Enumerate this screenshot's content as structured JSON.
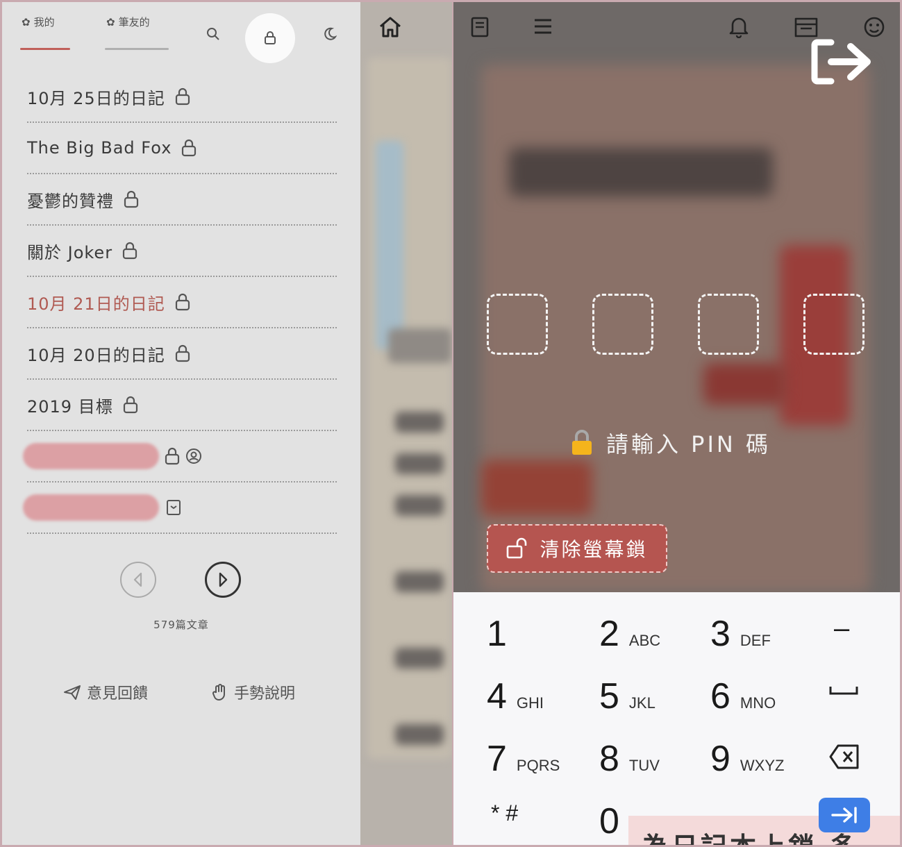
{
  "tabs": {
    "mine_label": "我的",
    "friends_label": "筆友的"
  },
  "diary_entries": [
    {
      "title": "10月 25日的日記",
      "icon": "lock-icon"
    },
    {
      "title": "The Big Bad Fox",
      "icon": "lock-icon"
    },
    {
      "title": "憂鬱的贊禮",
      "icon": "lock-icon"
    },
    {
      "title": "關於 Joker",
      "icon": "lock-icon"
    },
    {
      "title": "10月 21日的日記",
      "icon": "lock-icon",
      "active": true
    },
    {
      "title": "10月 20日的日記",
      "icon": "lock-icon"
    },
    {
      "title": "2019 目標",
      "icon": "lock-icon"
    }
  ],
  "post_count": "579篇文章",
  "footer": {
    "feedback_label": "意見回饋",
    "gesture_label": "手勢說明"
  },
  "pin": {
    "prompt": "請輸入 PIN 碼",
    "clear_label": "清除螢幕鎖"
  },
  "keypad": {
    "keys": [
      {
        "digit": "1",
        "letters": ""
      },
      {
        "digit": "2",
        "letters": "ABC"
      },
      {
        "digit": "3",
        "letters": "DEF"
      },
      {
        "digit": "–",
        "letters": ""
      },
      {
        "digit": "4",
        "letters": "GHI"
      },
      {
        "digit": "5",
        "letters": "JKL"
      },
      {
        "digit": "6",
        "letters": "MNO"
      },
      {
        "digit": "␣",
        "letters": ""
      },
      {
        "digit": "7",
        "letters": "PQRS"
      },
      {
        "digit": "8",
        "letters": "TUV"
      },
      {
        "digit": "9",
        "letters": "WXYZ"
      },
      {
        "digit": "⌫",
        "letters": ""
      },
      {
        "digit": "* #",
        "letters": ""
      },
      {
        "digit": "0",
        "letters": "+"
      }
    ]
  },
  "caption": "為日記本上鎖 多",
  "colors": {
    "accent_red": "#b05a52",
    "enter_blue": "#3e7ee6",
    "left_bg": "#e2e2e2"
  }
}
